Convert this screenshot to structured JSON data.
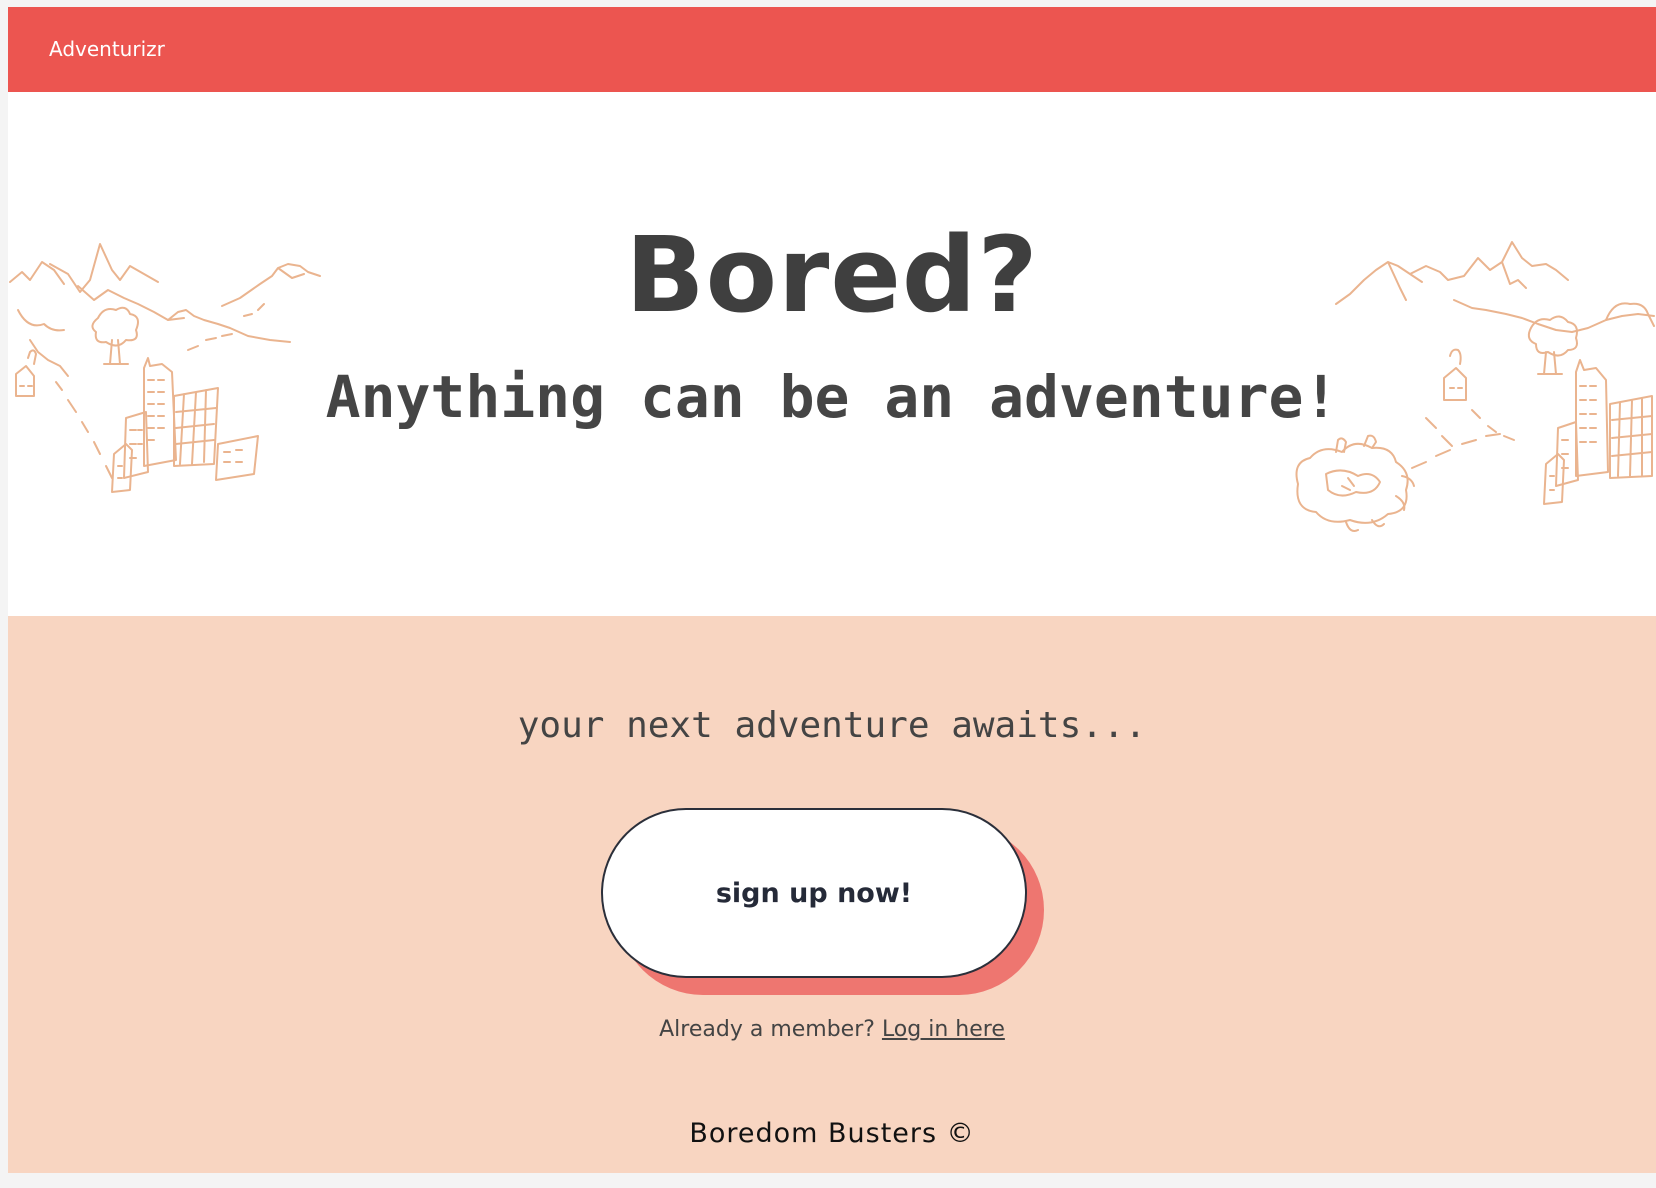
{
  "colors": {
    "topbar": "#ec5550",
    "hero_background": "#ffffff",
    "cta_background": "#f8d5c1",
    "button_shadow": "#ee7670",
    "sketch_stroke": "#eab48f",
    "heading_text": "#3f3f3f"
  },
  "topbar": {
    "brand": "Adventurizr"
  },
  "hero": {
    "title": "Bored?",
    "tagline": "Anything can be an adventure!",
    "decorations": [
      "mountain-town-sketch-left",
      "mountain-town-sketch-right"
    ]
  },
  "cta": {
    "subtitle": "your next adventure awaits...",
    "signup_label": "sign up now!",
    "login_prompt": "Already a member?",
    "login_link": "Log in here"
  },
  "footer": {
    "text": "Boredom Busters ©"
  }
}
